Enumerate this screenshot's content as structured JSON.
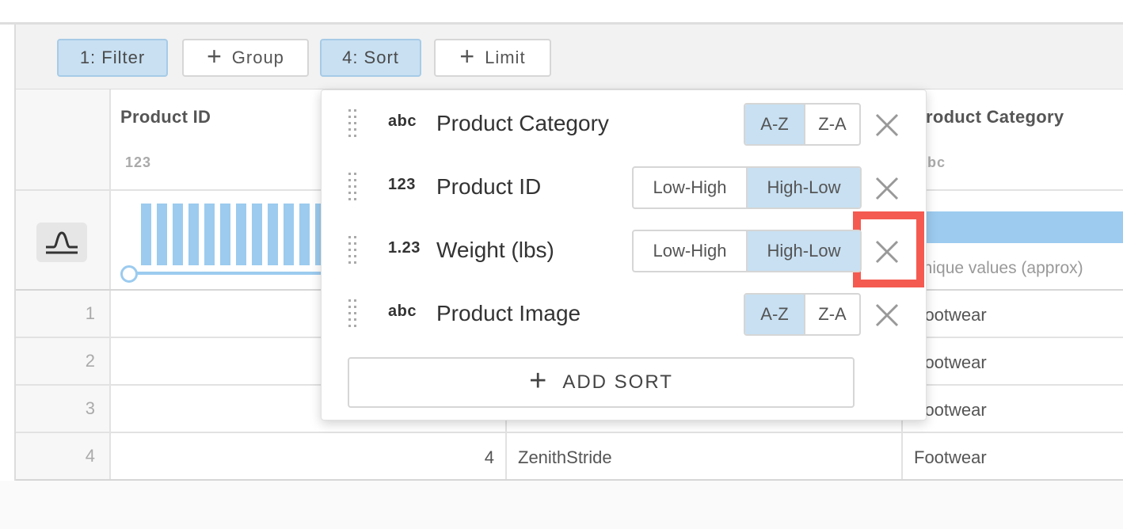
{
  "toolbar": {
    "filter_label": "1: Filter",
    "group_label": "Group",
    "sort_label": "4: Sort",
    "limit_label": "Limit"
  },
  "columns": [
    {
      "title": "Product ID",
      "type_icon": "123"
    },
    {
      "title": "Product Category",
      "type_icon": "abc"
    }
  ],
  "header_stats": {
    "category_unique": "unique values (approx)"
  },
  "rows": [
    {
      "num": "1",
      "product_id": "",
      "name": "",
      "category": "Footwear"
    },
    {
      "num": "2",
      "product_id": "",
      "name": "",
      "category": "Footwear"
    },
    {
      "num": "3",
      "product_id": "",
      "name": "",
      "category": "Footwear"
    },
    {
      "num": "4",
      "product_id": "4",
      "name": "ZenithStride",
      "category": "Footwear"
    }
  ],
  "sort_panel": {
    "items": [
      {
        "type_icon": "abc",
        "field": "Product Category",
        "options": [
          "A-Z",
          "Z-A"
        ],
        "selected": "A-Z"
      },
      {
        "type_icon": "123",
        "field": "Product ID",
        "options": [
          "Low-High",
          "High-Low"
        ],
        "selected": "High-Low"
      },
      {
        "type_icon": "1.23",
        "field": "Weight (lbs)",
        "options": [
          "Low-High",
          "High-Low"
        ],
        "selected": "High-Low"
      },
      {
        "type_icon": "abc",
        "field": "Product Image",
        "options": [
          "A-Z",
          "Z-A"
        ],
        "selected": "A-Z"
      }
    ],
    "add_sort_label": "ADD SORT"
  },
  "colors": {
    "accent_light": "#c8e0f2",
    "bar_blue": "#9ccbef",
    "highlight_red": "#f45a50"
  }
}
